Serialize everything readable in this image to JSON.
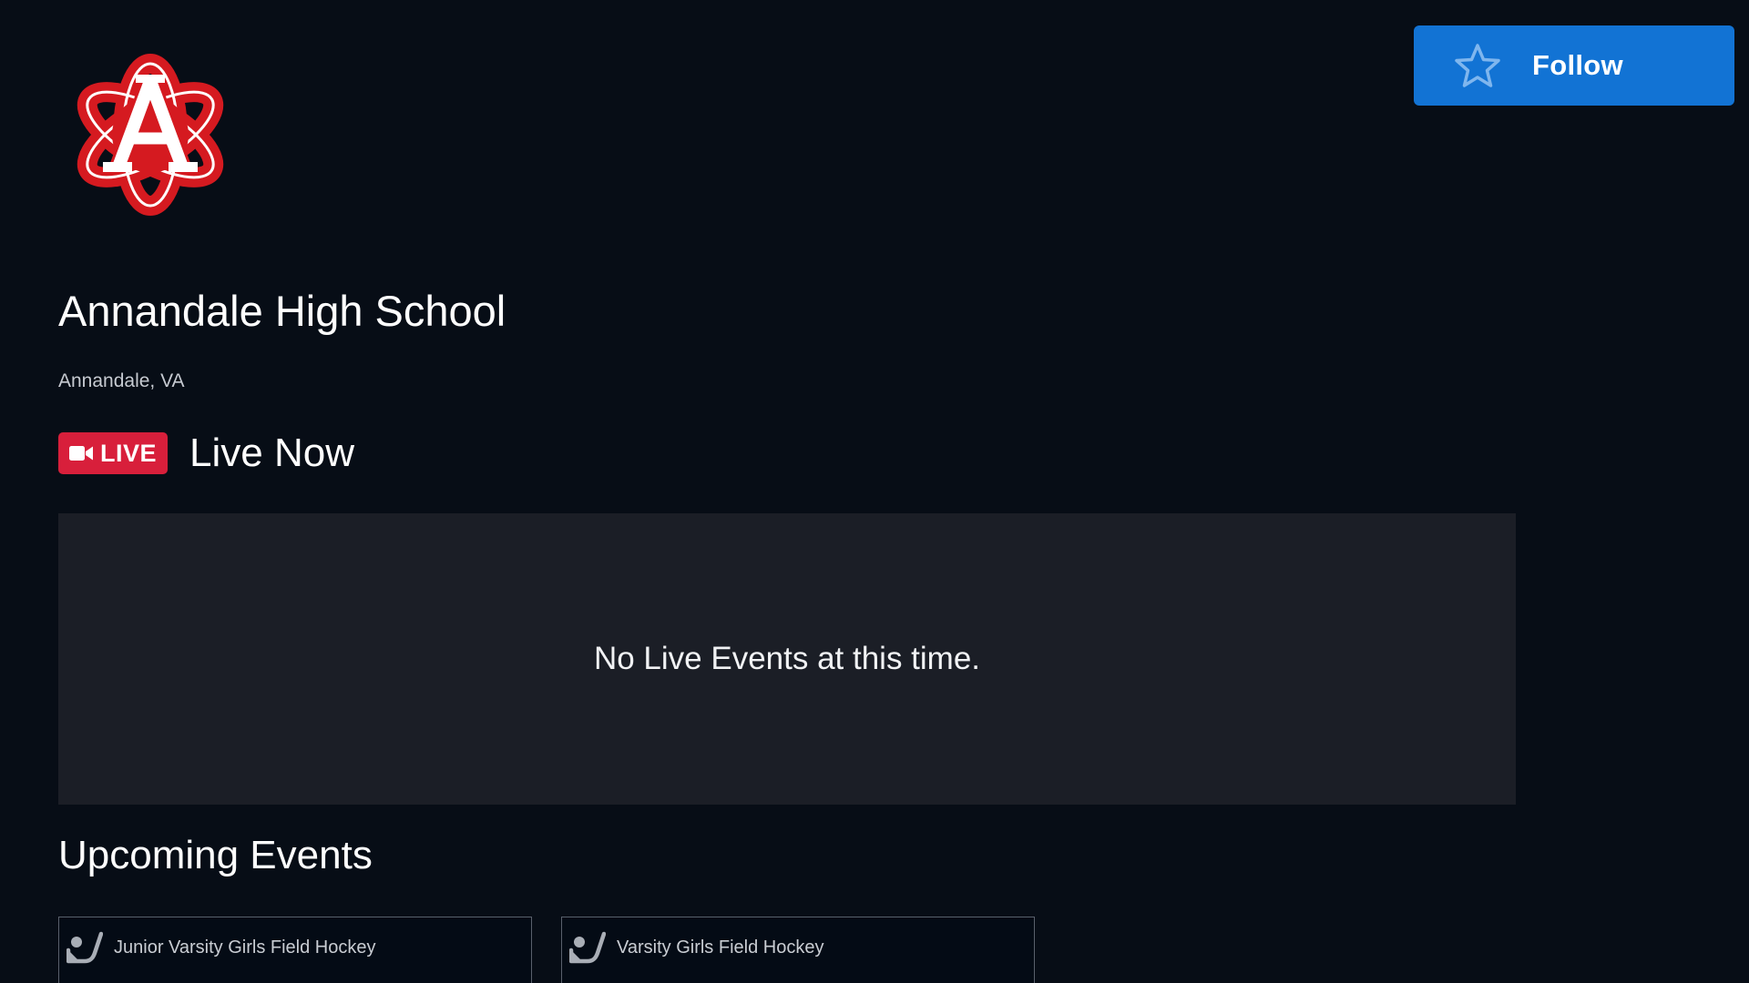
{
  "header": {
    "logo_icon": "school-atom-logo",
    "follow_label": "Follow",
    "follow_icon": "star-icon",
    "follow_color": "#1273d4"
  },
  "school": {
    "name": "Annandale High School",
    "location": "Annandale, VA"
  },
  "live_section": {
    "badge_label": "LIVE",
    "badge_icon": "video-camera-icon",
    "badge_color": "#d81f3b",
    "title": "Live Now",
    "empty_message": "No Live Events at this time."
  },
  "upcoming_section": {
    "title": "Upcoming Events",
    "events": [
      {
        "name": "Junior Varsity Girls Field Hockey",
        "icon": "field-hockey-icon"
      },
      {
        "name": "Varsity Girls Field Hockey",
        "icon": "field-hockey-icon"
      }
    ]
  }
}
